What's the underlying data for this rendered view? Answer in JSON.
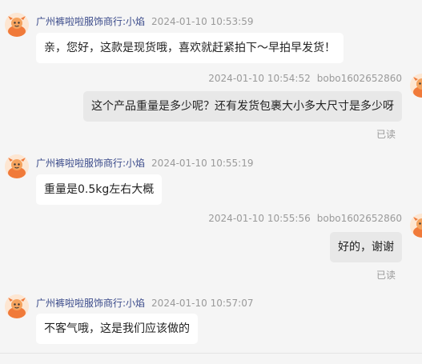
{
  "messages": [
    {
      "direction": "in",
      "sender": "广州裤啦啦服饰商行:小焰",
      "time": "2024-01-10 10:53:59",
      "text": "亲，您好，这款是现货哦，喜欢就赶紧拍下～早拍早发货！"
    },
    {
      "direction": "out",
      "sender": "bobo1602652860",
      "time": "2024-01-10 10:54:52",
      "text": "这个产品重量是多少呢？还有发货包裹大小多大尺寸是多少呀",
      "status": "已读"
    },
    {
      "direction": "in",
      "sender": "广州裤啦啦服饰商行:小焰",
      "time": "2024-01-10 10:55:19",
      "text": "重量是0.5kg左右大概"
    },
    {
      "direction": "out",
      "sender": "bobo1602652860",
      "time": "2024-01-10 10:55:56",
      "text": "好的，谢谢",
      "status": "已读"
    },
    {
      "direction": "in",
      "sender": "广州裤啦啦服饰商行:小焰",
      "time": "2024-01-10 10:57:07",
      "text": "不客气哦，这是我们应该做的"
    }
  ],
  "colors": {
    "background": "#f5f5f5",
    "incoming_bubble": "#ffffff",
    "outgoing_bubble": "#e8e8e8",
    "sender_name": "#3a4a8a",
    "timestamp": "#9a9a9a",
    "avatar_accent": "#f07a3a"
  },
  "icons": {
    "seller_avatar": "cartoon-mascot-avatar",
    "buyer_avatar": "cartoon-mascot-avatar"
  }
}
